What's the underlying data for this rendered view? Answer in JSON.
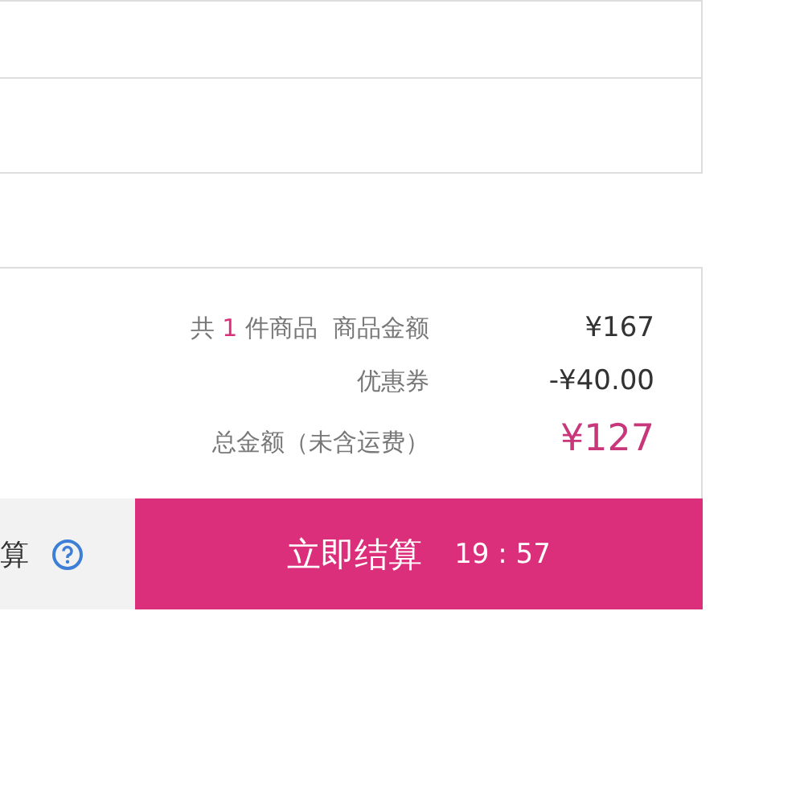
{
  "summary": {
    "count_prefix": "共",
    "count": "1",
    "count_suffix": "件商品",
    "rows": [
      {
        "kind": "subtotal",
        "label": "商品金额",
        "value": "¥167"
      },
      {
        "kind": "coupon",
        "label": "优惠券",
        "value": "-¥40.00"
      },
      {
        "kind": "total",
        "label": "总金额（未含运费）",
        "value": "¥127"
      }
    ]
  },
  "footer": {
    "left_text": "算",
    "checkout": {
      "label": "立即结算",
      "timer": "19 : 57"
    }
  }
}
